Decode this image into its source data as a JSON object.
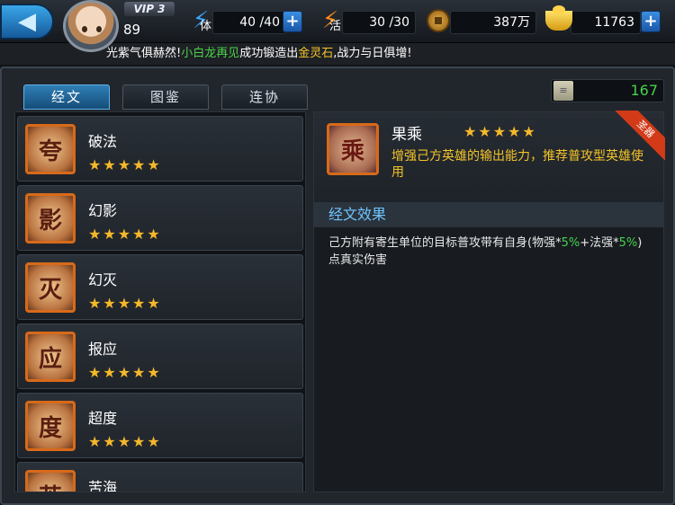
{
  "topbar": {
    "vip": "VIP 3",
    "level": "89",
    "stamina": {
      "label": "体",
      "value": "40 /40"
    },
    "vigor": {
      "label": "活",
      "value": "30 /30"
    },
    "copper": {
      "value": "387万"
    },
    "gold": {
      "value": "11763"
    },
    "plus": "+"
  },
  "ticker": {
    "part1": "光紫气俱赫然!",
    "player": "小白龙再见",
    "part2": "成功锻造出",
    "item": "金灵石",
    "part3": ",战力与日俱增!"
  },
  "tabs": [
    "经文",
    "图鉴",
    "连协"
  ],
  "scroll_count": "167",
  "scripture_list": [
    {
      "name": "破法",
      "stars": "★★★★★",
      "glyph": "夸"
    },
    {
      "name": "幻影",
      "stars": "★★★★★",
      "glyph": "影"
    },
    {
      "name": "幻灭",
      "stars": "★★★★★",
      "glyph": "灭"
    },
    {
      "name": "报应",
      "stars": "★★★★★",
      "glyph": "应"
    },
    {
      "name": "超度",
      "stars": "★★★★★",
      "glyph": "度"
    },
    {
      "name": "苦海",
      "stars": "★★★★★",
      "glyph": "苦"
    }
  ],
  "detail": {
    "name": "果乘",
    "stars": "★★★★★",
    "glyph": "乘",
    "ribbon": "圣器",
    "description": "增强己方英雄的输出能力，推荐普攻型英雄使用",
    "effect_title": "经文效果",
    "effect_a": "己方附有寄生单位的目标普攻带有自身(物强*",
    "effect_pct1": "5%",
    "effect_b": "+法强*",
    "effect_pct2": "5%",
    "effect_c": ")点真实伤害"
  },
  "colors": {
    "accent_blue": "#2f7fb6",
    "gold_text": "#f5c428",
    "green_text": "#46d24a",
    "star": "#f5b82a",
    "icon_border": "#d86a1a"
  }
}
